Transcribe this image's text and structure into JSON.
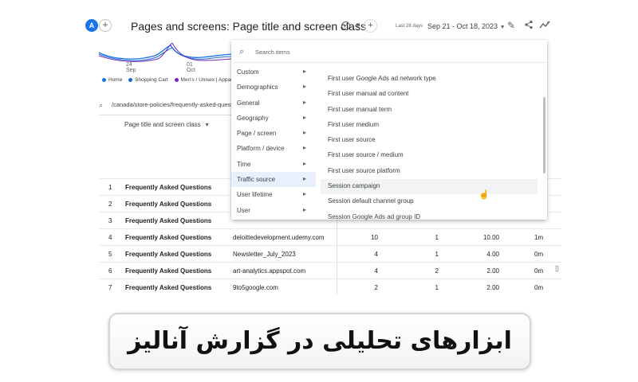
{
  "report": {
    "avatar_letter": "A",
    "title": "Pages and screens: Page title and screen class",
    "date_label": "Last 28 days",
    "date_range": "Sep 21 - Oct 18, 2023"
  },
  "icons": {
    "add": "plus-icon",
    "check": "check-circle-icon",
    "caret": "caret-down-icon",
    "edit": "edit-icon",
    "share": "share-icon",
    "insights": "insights-icon",
    "search": "search-icon",
    "arrow": "chevron-right-icon",
    "cursor": "hand-pointer-icon"
  },
  "mini_chart": {
    "x_ticks": [
      {
        "day": "24",
        "month": "Sep"
      },
      {
        "day": "01",
        "month": "Oct"
      }
    ],
    "legend": [
      {
        "label": "Home",
        "color": "#1a73e8"
      },
      {
        "label": "Shopping Cart",
        "color": "#1967d2"
      },
      {
        "label": "Men's / Unisex | Appar",
        "color": "#7627bb"
      }
    ]
  },
  "filter": {
    "path": "/canada/store-policies/frequently-asked-quest"
  },
  "table": {
    "dimension_header": "Page title and screen class",
    "rows": [
      {
        "n": "1",
        "title": "Frequently Asked Questions",
        "source": "",
        "a": "",
        "b": "",
        "c": "",
        "d": ""
      },
      {
        "n": "2",
        "title": "Frequently Asked Questions",
        "source": "",
        "a": "",
        "b": "",
        "c": "",
        "d": ""
      },
      {
        "n": "3",
        "title": "Frequently Asked Questions",
        "source": "",
        "a": "",
        "b": "",
        "c": "",
        "d": ""
      },
      {
        "n": "4",
        "title": "Frequently Asked Questions",
        "source": "deloittedevelopment.udemy.com",
        "a": "10",
        "b": "1",
        "c": "10.00",
        "d": "1m"
      },
      {
        "n": "5",
        "title": "Frequently Asked Questions",
        "source": "Newsletter_July_2023",
        "a": "4",
        "b": "1",
        "c": "4.00",
        "d": "0m"
      },
      {
        "n": "6",
        "title": "Frequently Asked Questions",
        "source": "art-analytics.appspot.com",
        "a": "4",
        "b": "2",
        "c": "2.00",
        "d": "0m"
      },
      {
        "n": "7",
        "title": "Frequently Asked Questions",
        "source": "9to5google.com",
        "a": "2",
        "b": "1",
        "c": "2.00",
        "d": "0m"
      }
    ]
  },
  "menu": {
    "search_placeholder": "Search items",
    "categories": [
      "Custom",
      "Demographics",
      "General",
      "Geography",
      "Page / screen",
      "Platform / device",
      "Time",
      "Traffic source",
      "User lifetime",
      "User"
    ],
    "active_category": "Traffic source",
    "items": [
      "First user Google Ads ad network type",
      "First user manual ad content",
      "First user manual term",
      "First user medium",
      "First user source",
      "First user source / medium",
      "First user source platform",
      "Session campaign",
      "Session default channel group",
      "Session Google Ads ad group ID"
    ],
    "hovered_item": "Session campaign"
  },
  "caption": {
    "text": "ابزارهای تحلیلی در گزارش آنالیز صفحات"
  }
}
